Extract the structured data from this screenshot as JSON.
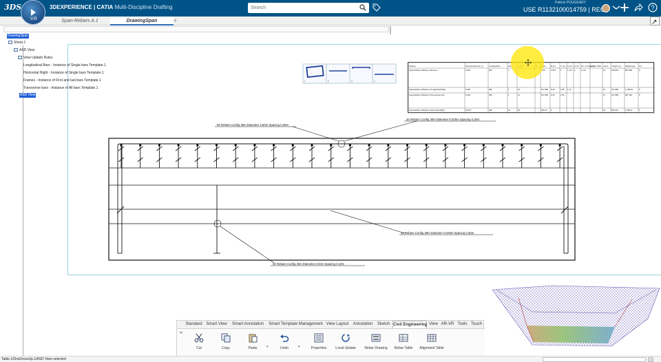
{
  "header": {
    "brand": "3DS",
    "compass_version": "V.R",
    "app_title_brand": "3DEXPERIENCE | CATIA",
    "app_title_sub": "Multi-Discipline Drafting",
    "search_placeholder": "Search",
    "user_name": "Patrick POUGEARY",
    "user_context": "USE R1132100014759 | REC",
    "colors": {
      "bar": "#005386",
      "accent": "#2a6ebb"
    }
  },
  "tabs": [
    {
      "label": "Span-Rebars A.1",
      "active": false
    },
    {
      "label": "DrawingSpan",
      "active": true
    }
  ],
  "tab_add": "+",
  "tree": {
    "root": "DrawingSpan",
    "sheet": "Sheet.1",
    "asd_view": "ASD View",
    "view_update_rules": "View Update Rules",
    "rules": [
      "Longitudinal Bars - Instance of Single bars Template.1",
      "Horizontal Right - Instance of Single bars Template.1",
      "Frames - Instance of First and last bars Template.1",
      "Transverse bars - Instance of All bars Template.1"
    ],
    "selected_view": "ASD View"
  },
  "drawing": {
    "callouts": [
      "50 Rebars Config 35H Diameter 4.60m Spacing 0.25m",
      "34 Rebars Config 35H Diameter 0.025m Spacing 0.25m",
      "1x Rebars Config 35H Diameter 0.025m Spacing 0.35m",
      "30 Rebars Config 45H Diameter 0.04m Spacing 0.10m"
    ],
    "thumb_labels": [
      "1",
      "2",
      "3",
      "4"
    ]
  },
  "table": {
    "headers": [
      "Feature",
      "Physical diameter (r)",
      "Configuration",
      "Color",
      "Length",
      "R",
      "A (m)",
      "B (m)",
      "C (m)",
      "D (m)",
      "E (m)",
      "Nb. of Instances",
      "Level of Bar",
      "Count",
      "Length (m)",
      "Weight (kg)",
      "Tot"
    ],
    "rows": [
      [
        "Span-Rebars 4/Rebars 1/Frames",
        "0.032",
        "35F",
        "1",
        "",
        "",
        "4.55",
        "1.875",
        "1",
        "1.377",
        "1",
        "1.112",
        "",
        "16",
        "156.832",
        "867.905",
        "5"
      ],
      [
        "Span-Rebars 4/Rebars 2/Longitudinal Bars",
        "0.025",
        "35F",
        "1",
        "21",
        "",
        "197.899",
        "9.25",
        "1.85",
        "1.12",
        "",
        "",
        "",
        "21",
        "197.899",
        "1,168.29",
        "5"
      ],
      [
        "Span-Rebars 4/Rebars 3/Transverse bars",
        "0.032",
        "35F",
        "1",
        "21",
        "",
        "197.899",
        "9.25",
        "1.85",
        "",
        "",
        "",
        "",
        "27",
        "197.899",
        "987.325",
        "5"
      ],
      [
        "Span-Rebars 4/Rebars 4/Horizontal Right",
        "0.0477",
        "45F",
        "1a",
        "30",
        "",
        "693.11",
        "4",
        "",
        "",
        "",
        "",
        "",
        "30",
        "693.911",
        "4,786.11",
        "5"
      ]
    ]
  },
  "ribbon": {
    "tabs": [
      "Standard",
      "Smart View",
      "Smart Annotation",
      "Smart Template Management",
      "View Layout",
      "Annotation",
      "Sketch",
      "Civil Engineering",
      "View",
      "AR-VR",
      "Tools",
      "Touch"
    ],
    "active_tab": "Civil Engineering",
    "commands": [
      "Cut",
      "Copy",
      "Paste",
      "Undo",
      "Properties",
      "Local Update",
      "Rebar Drawing",
      "Rebar Table",
      "Alignment Table"
    ]
  },
  "status": {
    "text": "Table.1/DrwDressUp.1/ASD View selected"
  }
}
